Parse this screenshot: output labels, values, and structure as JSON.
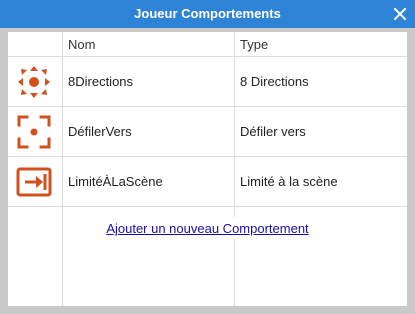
{
  "window": {
    "title": "Joueur Comportements",
    "title_bar_color": "#2f83d6",
    "close_icon": "close-icon"
  },
  "table": {
    "columns": {
      "name": "Nom",
      "type": "Type"
    },
    "rows": [
      {
        "icon": "eight-direction-arrows-icon",
        "name": "8Directions",
        "type": "8 Directions"
      },
      {
        "icon": "scroll-to-target-icon",
        "name": "DéfilerVers",
        "type": "Défiler vers"
      },
      {
        "icon": "bound-to-layout-icon",
        "name": "LimitéÀLaScène",
        "type": "Limité à la scène"
      }
    ]
  },
  "actions": {
    "add_behavior": "Ajouter un nouveau Comportement"
  },
  "colors": {
    "icon_accent": "#d2501e",
    "link": "#1a0dab"
  }
}
